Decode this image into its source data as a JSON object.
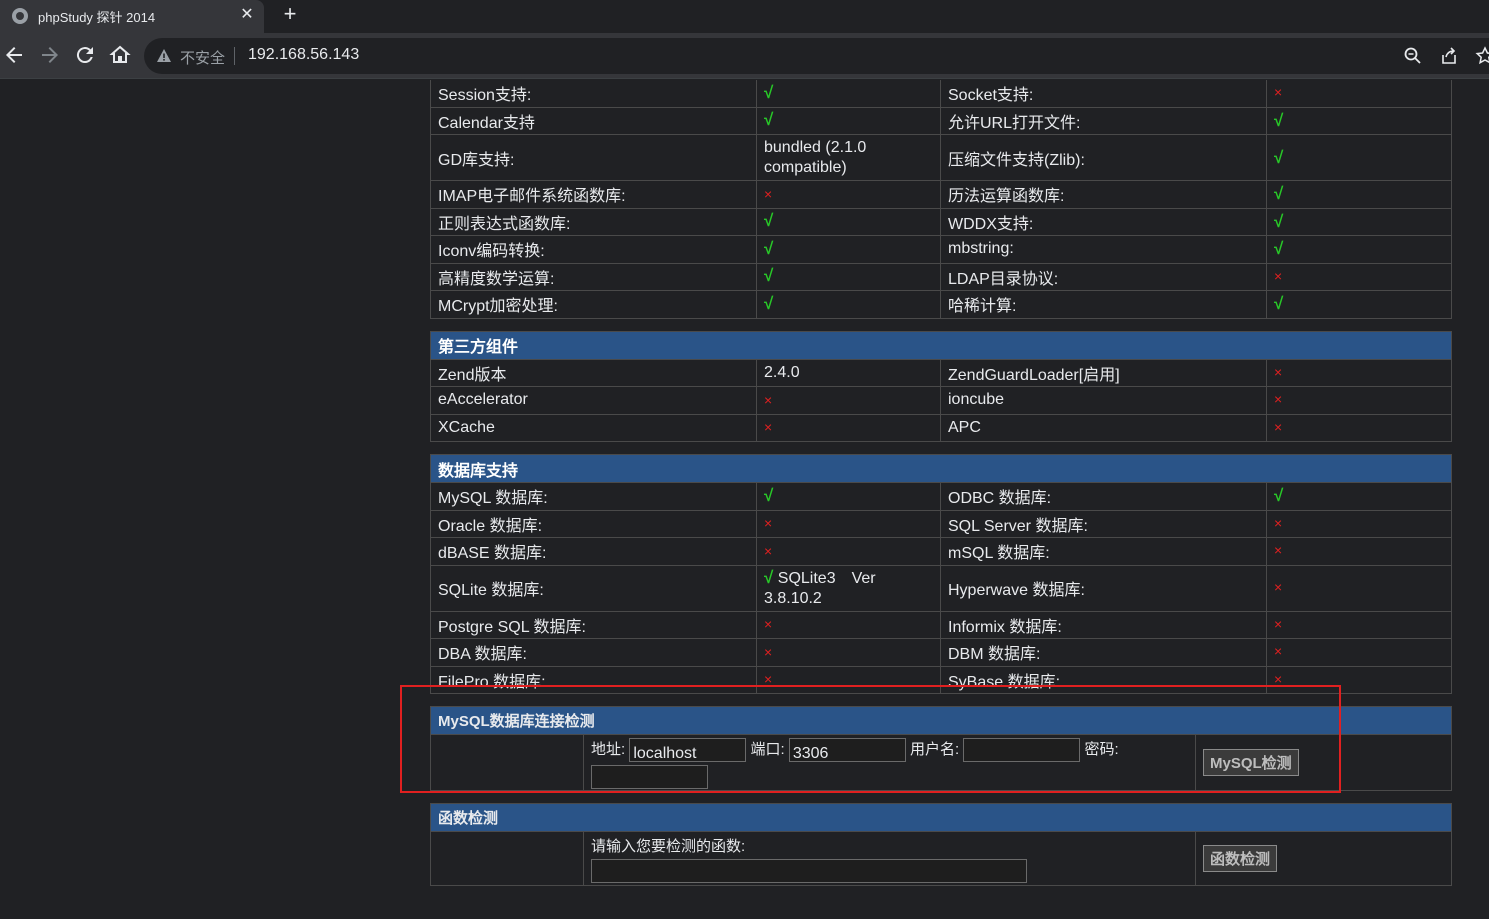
{
  "browser": {
    "tab_title": "phpStudy 探针 2014",
    "tab_close": "✕",
    "new_tab": "+",
    "insecure_label": "不安全",
    "url": "192.168.56.143"
  },
  "php_rows": [
    {
      "a": "Session支持:",
      "b": "√",
      "b_ok": true,
      "c": "Socket支持:",
      "d": "×",
      "d_ok": false
    },
    {
      "a": "Calendar支持",
      "b": "√",
      "b_ok": true,
      "c": "允许URL打开文件:",
      "d": "√",
      "d_ok": true
    },
    {
      "a": "GD库支持:",
      "b": "bundled (2.1.0 compatible)",
      "b_ok": null,
      "c": "压缩文件支持(Zlib):",
      "d": "√",
      "d_ok": true
    },
    {
      "a": "IMAP电子邮件系统函数库:",
      "b": "×",
      "b_ok": false,
      "c": "历法运算函数库:",
      "d": "√",
      "d_ok": true
    },
    {
      "a": "正则表达式函数库:",
      "b": "√",
      "b_ok": true,
      "c": "WDDX支持:",
      "d": "√",
      "d_ok": true
    },
    {
      "a": "Iconv编码转换:",
      "b": "√",
      "b_ok": true,
      "c": "mbstring:",
      "d": "√",
      "d_ok": true
    },
    {
      "a": "高精度数学运算:",
      "b": "√",
      "b_ok": true,
      "c": "LDAP目录协议:",
      "d": "×",
      "d_ok": false
    },
    {
      "a": "MCrypt加密处理:",
      "b": "√",
      "b_ok": true,
      "c": "哈稀计算:",
      "d": "√",
      "d_ok": true
    }
  ],
  "third_party": {
    "title": "第三方组件",
    "rows": [
      {
        "a": "Zend版本",
        "b": "2.4.0",
        "b_ok": null,
        "c": "ZendGuardLoader[启用]",
        "d": "×",
        "d_ok": false
      },
      {
        "a": "eAccelerator",
        "b": "×",
        "b_ok": false,
        "c": "ioncube",
        "d": "×",
        "d_ok": false
      },
      {
        "a": "XCache",
        "b": "×",
        "b_ok": false,
        "c": "APC",
        "d": "×",
        "d_ok": false
      }
    ]
  },
  "database": {
    "title": "数据库支持",
    "rows": [
      {
        "a": "MySQL 数据库:",
        "b": "√",
        "b_ok": true,
        "c": "ODBC 数据库:",
        "d": "√",
        "d_ok": true
      },
      {
        "a": "Oracle 数据库:",
        "b": "×",
        "b_ok": false,
        "c": "SQL Server 数据库:",
        "d": "×",
        "d_ok": false
      },
      {
        "a": "dBASE 数据库:",
        "b": "×",
        "b_ok": false,
        "c": "mSQL 数据库:",
        "d": "×",
        "d_ok": false
      },
      {
        "a": "SQLite 数据库:",
        "b": "√",
        "b_ok": true,
        "b_extra": "SQLite3　Ver 3.8.10.2",
        "c": "Hyperwave 数据库:",
        "d": "×",
        "d_ok": false
      },
      {
        "a": "Postgre SQL 数据库:",
        "b": "×",
        "b_ok": false,
        "c": "Informix 数据库:",
        "d": "×",
        "d_ok": false
      },
      {
        "a": "DBA 数据库:",
        "b": "×",
        "b_ok": false,
        "c": "DBM 数据库:",
        "d": "×",
        "d_ok": false
      },
      {
        "a": "FilePro 数据库:",
        "b": "×",
        "b_ok": false,
        "c": "SyBase 数据库:",
        "d": "×",
        "d_ok": false
      }
    ]
  },
  "mysql_check": {
    "title": "MySQL数据库连接检测",
    "host_label": "地址:",
    "host_value": "localhost",
    "port_label": "端口:",
    "port_value": "3306",
    "user_label": "用户名:",
    "user_value": "",
    "password_label": "密码:",
    "password_value": "",
    "button": "MySQL检测"
  },
  "function_check": {
    "title": "函数检测",
    "prompt": "请输入您要检测的函数:",
    "value": "",
    "button": "函数检测"
  },
  "colors": {
    "section_header": "#2a5488",
    "ok": "#28c828",
    "fail": "#e02020",
    "highlight_box": "#e02020"
  }
}
